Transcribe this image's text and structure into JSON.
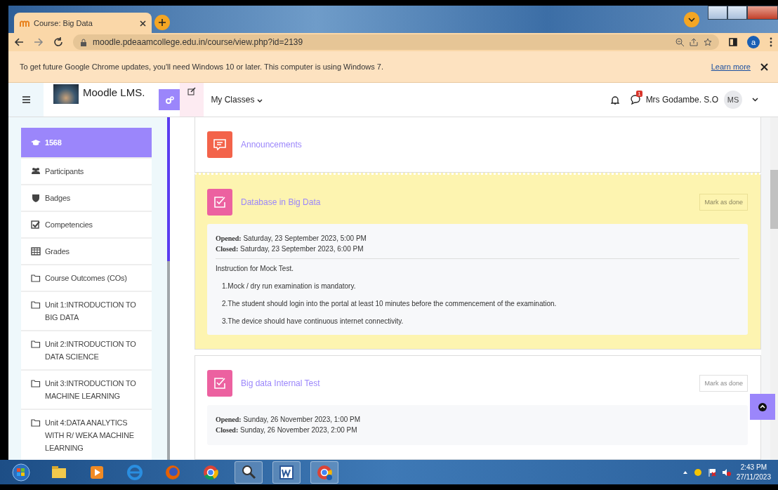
{
  "browser": {
    "tab_title": "Course: Big Data",
    "url": "moodle.pdeaamcollege.edu.in/course/view.php?id=2139",
    "profile_initial": "a",
    "infobar": {
      "message": "To get future Google Chrome updates, you'll need Windows 10 or later. This computer is using Windows 7.",
      "link": "Learn more"
    }
  },
  "navbar": {
    "site_name": "Moodle LMS.",
    "menu": "My Classes",
    "message_badge": "1",
    "user_name": "Mrs Godambe. S.O",
    "avatar_initials": "MS"
  },
  "drawer": {
    "items": [
      {
        "kind": "course",
        "label": "1568",
        "selected": true
      },
      {
        "kind": "participants",
        "label": "Participants",
        "selected": false
      },
      {
        "kind": "badges",
        "label": "Badges",
        "selected": false
      },
      {
        "kind": "competencies",
        "label": "Competencies",
        "selected": false
      },
      {
        "kind": "grades",
        "label": "Grades",
        "selected": false
      },
      {
        "kind": "section",
        "label": "Course Outcomes (COs)",
        "selected": false
      },
      {
        "kind": "section",
        "label": "Unit 1:INTRODUCTION TO BIG DATA",
        "selected": false
      },
      {
        "kind": "section",
        "label": "Unit 2:INTRODUCTION TO DATA SCIENCE",
        "selected": false
      },
      {
        "kind": "section",
        "label": "Unit 3:INTRODUCTION TO MACHINE LEARNING",
        "selected": false
      },
      {
        "kind": "section",
        "label": "Unit 4:DATA ANALYTICS WITH R/ WEKA MACHINE LEARNING",
        "selected": false
      }
    ]
  },
  "activities": [
    {
      "kind": "forum",
      "title": "Announcements",
      "highlighted": false
    },
    {
      "kind": "assignment",
      "title": "Database in Big Data",
      "highlighted": true,
      "mark_button": "Mark as done",
      "dates": [
        "**Opened:** Saturday, 23 September 2023, 5:00 PM",
        "**Closed:** Saturday, 23 September 2023, 6:00 PM"
      ],
      "description": [
        {
          "kind": "heading",
          "text": "Instruction for Mock Test."
        },
        {
          "kind": "item",
          "text": "1.Mock / dry run examination is mandatory."
        },
        {
          "kind": "item",
          "text": "2.The student should login into the portal at least 10 minutes before the commencement of the examination."
        },
        {
          "kind": "item",
          "text": "3.The device should have continuous internet connectivity."
        }
      ]
    },
    {
      "kind": "assignment",
      "title": "Big data Internal Test",
      "highlighted": false,
      "mark_button": "Mark as done",
      "dates": [
        "**Opened:** Sunday, 26 November 2023, 1:00 PM",
        "**Closed:** Sunday, 26 November 2023, 2:00 PM"
      ]
    }
  ],
  "taskbar": {
    "time": "2:43 PM",
    "date": "27/11/2023"
  }
}
